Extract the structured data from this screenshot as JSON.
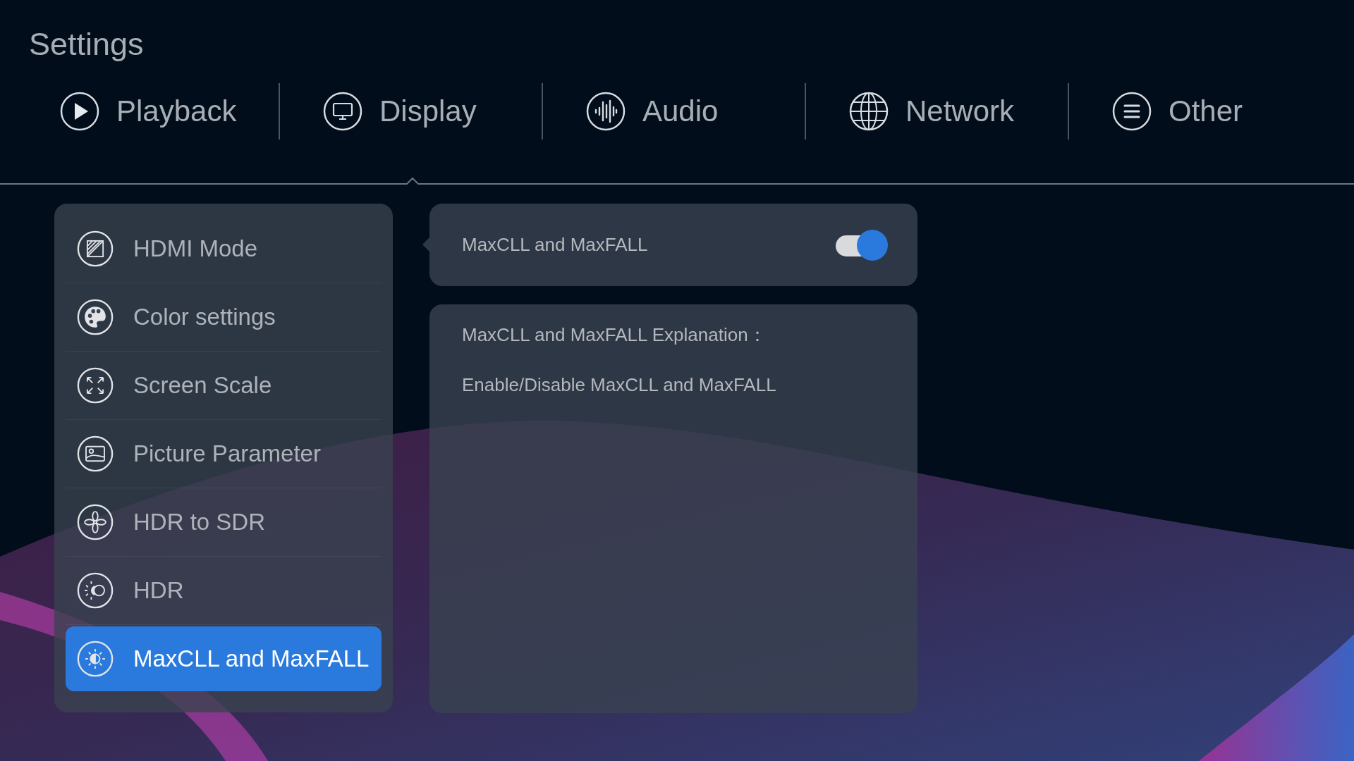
{
  "title": "Settings",
  "tabs": [
    {
      "label": "Playback",
      "selected": false
    },
    {
      "label": "Display",
      "selected": true
    },
    {
      "label": "Audio",
      "selected": false
    },
    {
      "label": "Network",
      "selected": false
    },
    {
      "label": "Other",
      "selected": false
    }
  ],
  "menu": [
    {
      "label": "HDMI Mode",
      "selected": false
    },
    {
      "label": "Color settings",
      "selected": false
    },
    {
      "label": "Screen Scale",
      "selected": false
    },
    {
      "label": "Picture Parameter",
      "selected": false
    },
    {
      "label": "HDR to SDR",
      "selected": false
    },
    {
      "label": "HDR",
      "selected": false
    },
    {
      "label": "MaxCLL and MaxFALL",
      "selected": true
    }
  ],
  "setting": {
    "label": "MaxCLL and MaxFALL",
    "on": true
  },
  "explanation": {
    "heading": "MaxCLL and MaxFALL Explanation：",
    "text": "Enable/Disable MaxCLL and MaxFALL"
  }
}
